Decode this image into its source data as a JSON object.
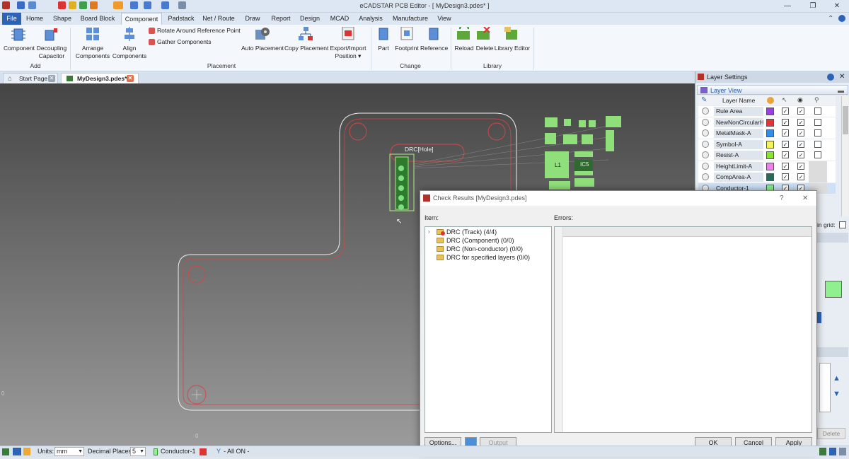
{
  "app": {
    "title": "eCADSTAR PCB Editor - [ MyDesign3.pdes* ]"
  },
  "menu": [
    "File",
    "Home",
    "Shape",
    "Board Block",
    "Component",
    "Padstack",
    "Net / Route",
    "Draw",
    "Report",
    "Design",
    "MCAD",
    "Analysis",
    "Manufacture",
    "View"
  ],
  "ribbon": {
    "add": {
      "component": "Component",
      "decoupling1": "Decoupling",
      "decoupling2": "Capacitor",
      "group": "Add"
    },
    "placement": {
      "arrange1": "Arrange",
      "arrange2": "Components",
      "align1": "Align",
      "align2": "Components",
      "rotate": "Rotate Around Reference Point",
      "gather": "Gather Components",
      "auto": "Auto Placement",
      "copy": "Copy Placement",
      "export1": "Export/Import",
      "export2": "Position",
      "group": "Placement"
    },
    "change": {
      "part": "Part",
      "footprint": "Footprint",
      "reference": "Reference",
      "group": "Change"
    },
    "library": {
      "reload": "Reload",
      "delete": "Delete",
      "libedit": "Library Editor",
      "group": "Library"
    }
  },
  "tabs": {
    "start": "Start Page",
    "design": "MyDesign3.pdes*"
  },
  "canvas": {
    "drc_label": "DRC[Hole]",
    "ref_l1": "L1",
    "ref_ic5": "IC5",
    "axis_zero_y": "0",
    "axis_zero_x": "0"
  },
  "layer_settings": {
    "title": "Layer Settings",
    "view": "Layer View",
    "col_name": "Layer Name",
    "rows": [
      {
        "name": "Rule Area",
        "color": "#9a3ee6"
      },
      {
        "name": "NewNonCircularHo",
        "color": "#e43434"
      },
      {
        "name": "MetalMask-A",
        "color": "#2e8ee8"
      },
      {
        "name": "Symbol-A",
        "color": "#f4f45a"
      },
      {
        "name": "Resist-A",
        "color": "#86e62a"
      },
      {
        "name": "HeightLimit-A",
        "color": "#ee80ee"
      },
      {
        "name": "CompArea-A",
        "color": "#2a6a5a"
      },
      {
        "name": "Conductor-1",
        "color": "#90f090"
      }
    ],
    "in_grid": "in grid:",
    "delete": "Delete"
  },
  "dialog": {
    "title": "Check Results [MyDesign3.pdes]",
    "help": "?",
    "close": "✕",
    "item_label": "Item:",
    "errors_label": "Errors:",
    "tree": [
      "DRC (Track) (4/4)",
      "DRC (Component) (0/0)",
      "DRC (Non-conductor) (0/0)",
      "DRC for specified layers (0/0)"
    ],
    "options": "Options...",
    "output": "Output File...",
    "ok": "OK",
    "cancel": "Cancel",
    "apply": "Apply"
  },
  "status": {
    "units_label": "Units:",
    "units": "mm",
    "dec_label": "Decimal Places:",
    "dec": "5",
    "layer": "Conductor-1",
    "allon": "- All ON -"
  }
}
